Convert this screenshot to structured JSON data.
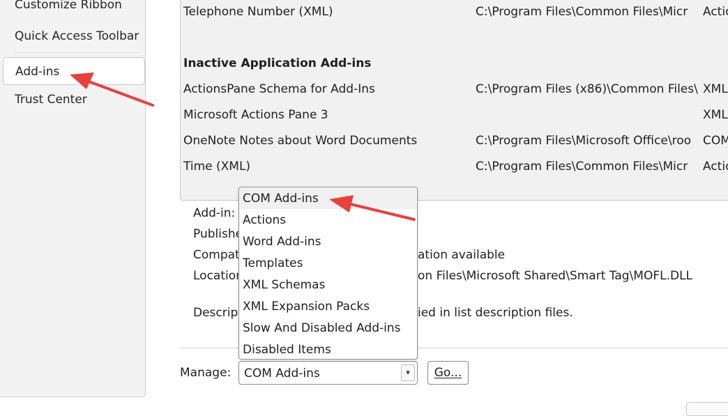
{
  "sidebar": {
    "items": [
      {
        "label": "Customize Ribbon"
      },
      {
        "label": "Quick Access Toolbar"
      },
      {
        "label": "Add-ins"
      },
      {
        "label": "Trust Center"
      }
    ]
  },
  "addins": {
    "rows": [
      {
        "name": "Telephone Number (XML)",
        "location": "C:\\Program Files\\Common Files\\Micr",
        "type": "Actio"
      },
      {
        "name": "Inactive Application Add-ins"
      },
      {
        "name": "ActionsPane Schema for Add-Ins",
        "location": "C:\\Program Files (x86)\\Common Files\\",
        "type": "XML"
      },
      {
        "name": "Microsoft Actions Pane 3",
        "location": "",
        "type": "XML"
      },
      {
        "name": "OneNote Notes about Word Documents",
        "location": "C:\\Program Files\\Microsoft Office\\roo",
        "type": "COM"
      },
      {
        "name": "Time (XML)",
        "location": "C:\\Program Files\\Common Files\\Micr",
        "type": "Actio"
      }
    ]
  },
  "details": {
    "addin_label": "Add-in:",
    "publisher_label": "Publishe",
    "compat_label": "Compat",
    "compat_value": "ation available",
    "location_label": "Location",
    "location_value": "on Files\\Microsoft Shared\\Smart Tag\\MOFL.DLL",
    "description_label": "Descript",
    "description_value": "ied in list description files."
  },
  "manage": {
    "label": "Manage:",
    "selected": "COM Add-ins",
    "go_label": "Go...",
    "options": [
      "COM Add-ins",
      "Actions",
      "Word Add-ins",
      "Templates",
      "XML Schemas",
      "XML Expansion Packs",
      "Slow And Disabled Add-ins",
      "Disabled Items"
    ]
  },
  "colors": {
    "annotation_arrow": "#e8403a",
    "selected_nav_bg": "#ffffff",
    "sidebar_bg": "#f3f3f3"
  }
}
